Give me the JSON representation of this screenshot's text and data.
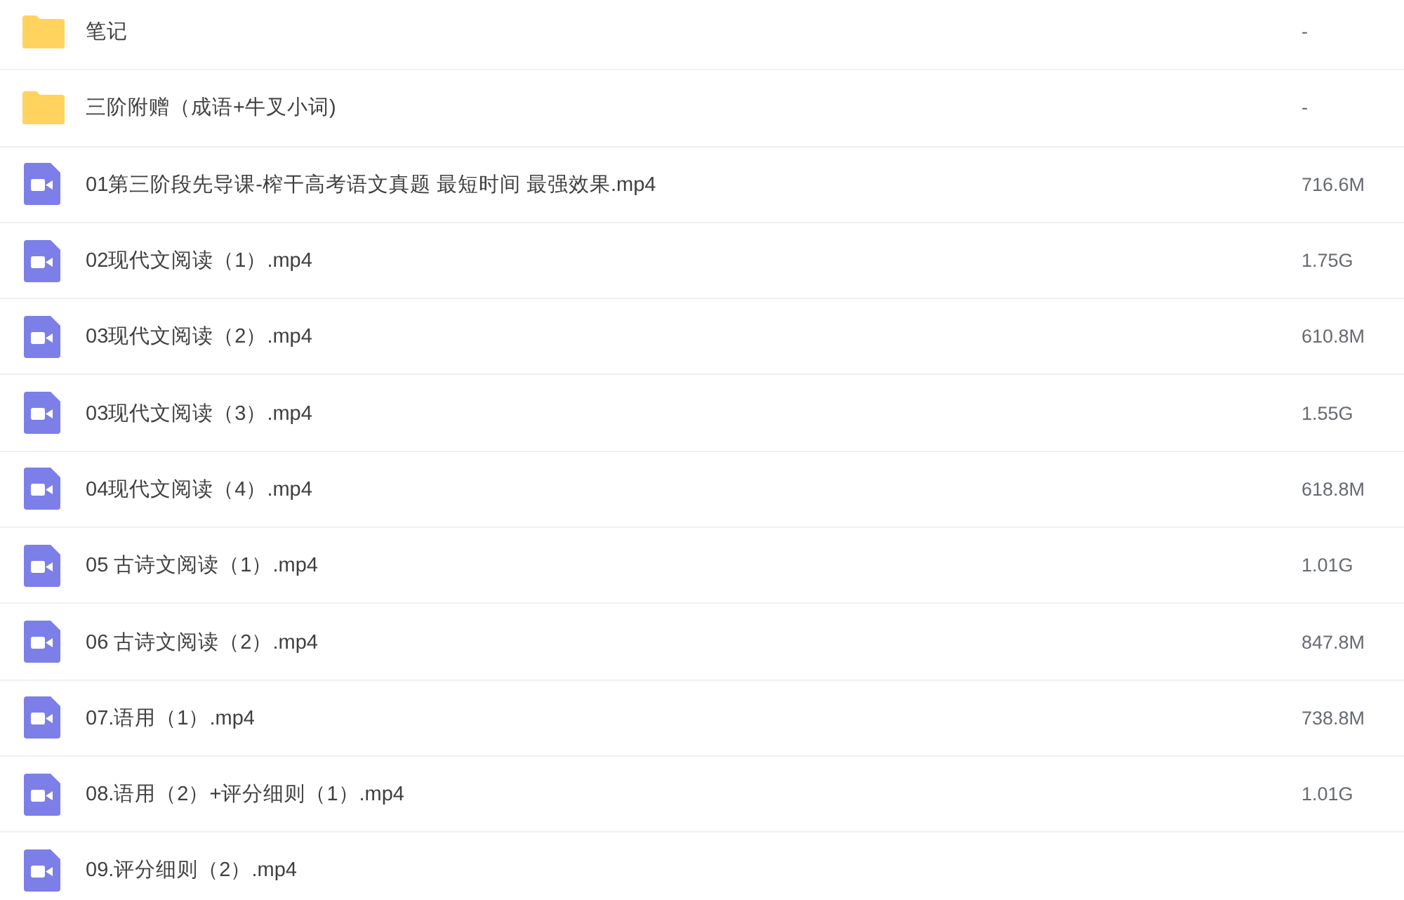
{
  "files": [
    {
      "kind": "folder",
      "name": "笔记",
      "size": "-"
    },
    {
      "kind": "folder",
      "name": "三阶附赠（成语+牛叉小词)",
      "size": "-"
    },
    {
      "kind": "video",
      "name": "01第三阶段先导课-榨干高考语文真题 最短时间 最强效果.mp4",
      "size": "716.6M"
    },
    {
      "kind": "video",
      "name": "02现代文阅读（1）.mp4",
      "size": "1.75G"
    },
    {
      "kind": "video",
      "name": "03现代文阅读（2）.mp4",
      "size": "610.8M"
    },
    {
      "kind": "video",
      "name": "03现代文阅读（3）.mp4",
      "size": "1.55G"
    },
    {
      "kind": "video",
      "name": "04现代文阅读（4）.mp4",
      "size": "618.8M"
    },
    {
      "kind": "video",
      "name": "05 古诗文阅读（1）.mp4",
      "size": "1.01G"
    },
    {
      "kind": "video",
      "name": "06 古诗文阅读（2）.mp4",
      "size": "847.8M"
    },
    {
      "kind": "video",
      "name": "07.语用（1）.mp4",
      "size": "738.8M"
    },
    {
      "kind": "video",
      "name": "08.语用（2）+评分细则（1）.mp4",
      "size": "1.01G"
    },
    {
      "kind": "video",
      "name": "09.评分细则（2）.mp4"
    }
  ]
}
